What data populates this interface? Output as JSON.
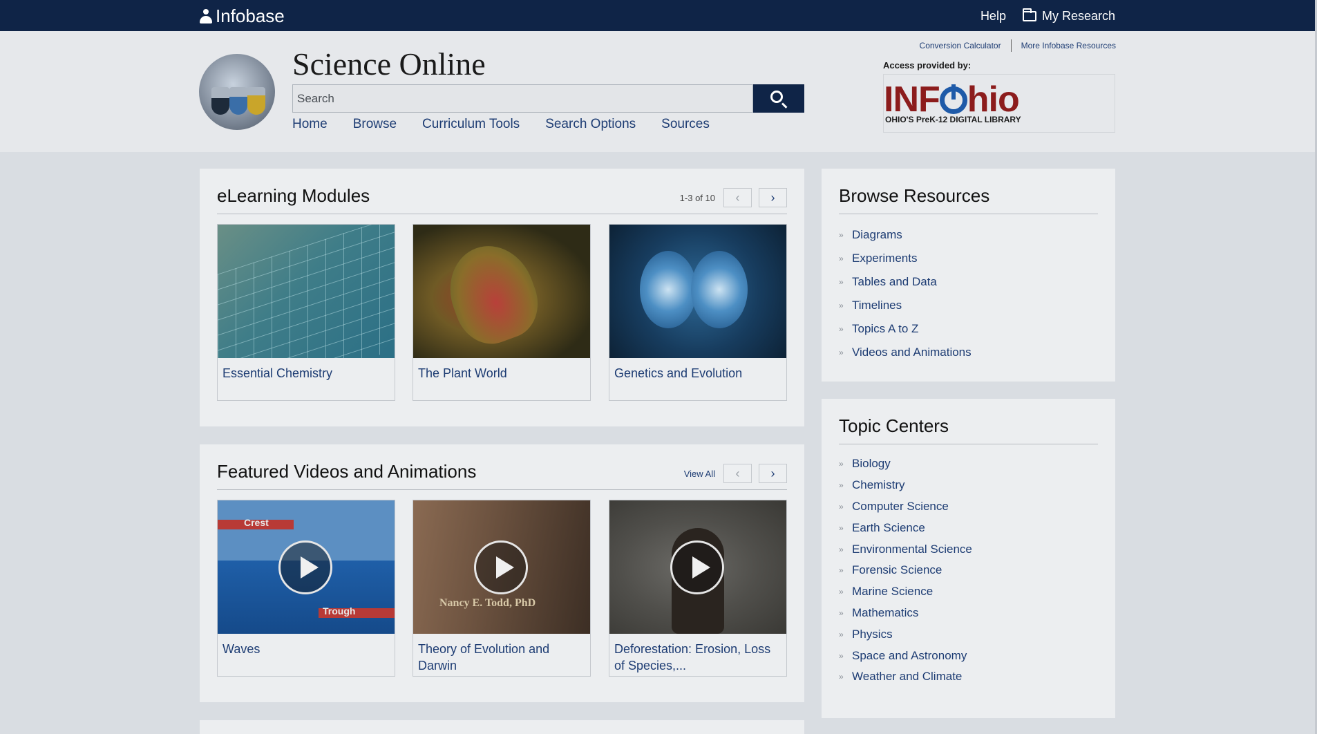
{
  "topbar": {
    "brand": "Infobase",
    "help": "Help",
    "my_research": "My Research"
  },
  "header": {
    "title": "Science Online",
    "search_placeholder": "Search",
    "nav": [
      "Home",
      "Browse",
      "Curriculum Tools",
      "Search Options",
      "Sources"
    ],
    "util_links": [
      "Conversion Calculator",
      "More Infobase Resources"
    ],
    "access_label": "Access provided by:",
    "provider_logo_text": "INFOhio",
    "provider_logo_sub": "OHIO'S PreK-12 DIGITAL LIBRARY"
  },
  "elearning": {
    "title": "eLearning Modules",
    "count": "1-3 of 10",
    "cards": [
      "Essential Chemistry",
      "The Plant World",
      "Genetics and Evolution"
    ]
  },
  "videos": {
    "title": "Featured Videos and Animations",
    "view_all": "View All",
    "cards": [
      "Waves",
      "Theory of Evolution and Darwin",
      "Deforestation: Erosion, Loss of Species,..."
    ],
    "waves_labels": [
      "Crest",
      "Trough"
    ],
    "darwin_caption": "Nancy E. Todd, PhD"
  },
  "browse_resources": {
    "title": "Browse Resources",
    "items": [
      "Diagrams",
      "Experiments",
      "Tables and Data",
      "Timelines",
      "Topics A to Z",
      "Videos and Animations"
    ]
  },
  "topic_centers": {
    "title": "Topic Centers",
    "items": [
      "Biology",
      "Chemistry",
      "Computer Science",
      "Earth Science",
      "Environmental Science",
      "Forensic Science",
      "Marine Science",
      "Mathematics",
      "Physics",
      "Space and Astronomy",
      "Weather and Climate"
    ]
  },
  "icons": {
    "search": "magnifier-icon",
    "folder": "folder-icon",
    "prev": "chevron-left-icon",
    "next": "chevron-right-icon",
    "bullet": "double-chevron-right-icon",
    "play": "play-icon"
  },
  "colors": {
    "navy": "#0f2447",
    "link": "#1d3c73",
    "panel": "#eceef0",
    "page": "#d9dde2"
  }
}
